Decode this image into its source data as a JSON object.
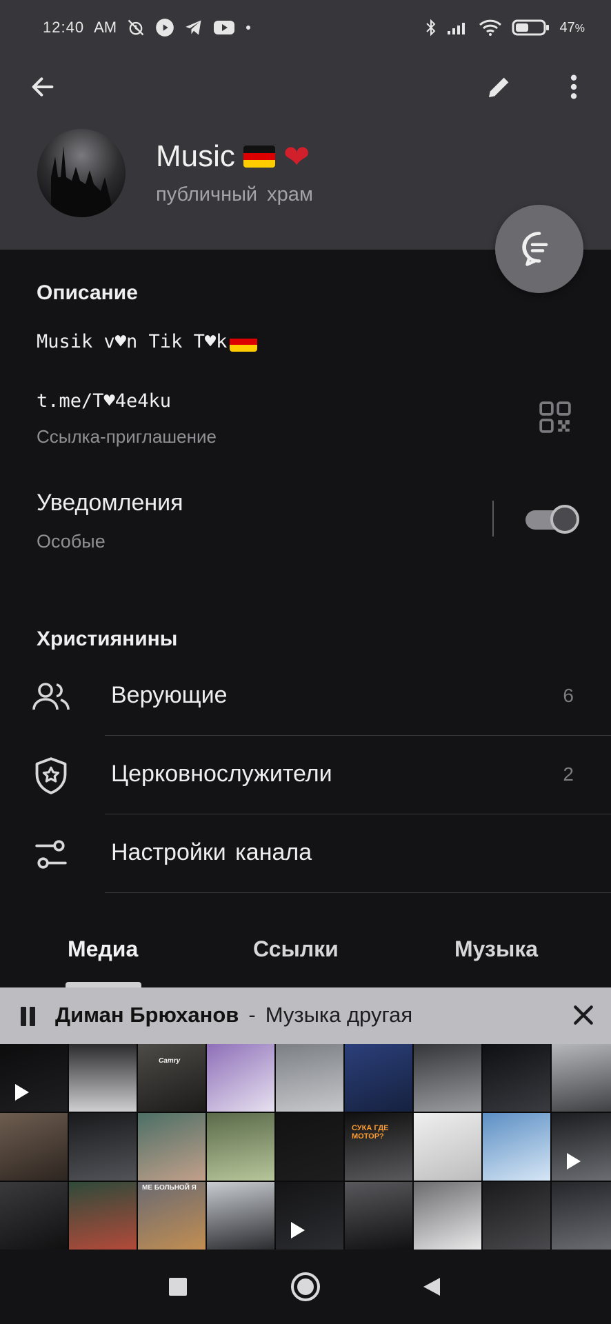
{
  "status_bar": {
    "time": "12:40",
    "ampm": "AM",
    "battery_text": "47",
    "battery_unit": "%",
    "battery_level": 0.47,
    "icons_left": [
      "alarm-off-icon",
      "youtube-music-icon",
      "telegram-icon",
      "youtube-icon",
      "dot-icon"
    ],
    "icons_right": [
      "bluetooth-icon",
      "signal-icon",
      "wifi-icon",
      "battery-icon"
    ]
  },
  "header": {
    "back_icon": "arrow-left-icon",
    "edit_icon": "pencil-icon",
    "more_icon": "more-vertical-icon",
    "channel_name": "Music",
    "channel_emoji": [
      "flag-germany",
      "red-heart"
    ],
    "channel_subtitle": "публичный храм"
  },
  "fab": {
    "icon": "chat-bubble-icon"
  },
  "description": {
    "section_title": "Описание",
    "text": "Musik v♥n Tik T♥k",
    "text_emoji": "flag-germany"
  },
  "invite_link": {
    "url": "t.me/T♥4e4ku",
    "label": "Ссылка-приглашение",
    "qr_icon": "qr-code-icon"
  },
  "notifications": {
    "title": "Уведомления",
    "subtitle": "Особые",
    "enabled": true
  },
  "members_section": {
    "title": "Християнины",
    "rows": [
      {
        "label": "Верующие",
        "count": "6",
        "icon": "users-icon"
      },
      {
        "label": "Церковнослужители",
        "count": "2",
        "icon": "shield-star-icon"
      },
      {
        "label": "Настройки канала",
        "count": "",
        "icon": "sliders-icon"
      }
    ]
  },
  "tabs": [
    {
      "label": "Медиа",
      "active": true
    },
    {
      "label": "Ссылки",
      "active": false
    },
    {
      "label": "Музыка",
      "active": false
    }
  ],
  "player": {
    "artist": "Диман Брюханов",
    "separator": "-",
    "track": "Музыка другая",
    "pause_icon": "pause-icon",
    "close_icon": "close-icon"
  },
  "media_grid": {
    "captions": {
      "c2": "Camry",
      "c14": "СУКА ГДЕ МОТОР?",
      "c20": "МЕ БОЛЬНОЙ Я"
    },
    "video_cells": [
      0,
      17,
      22
    ]
  },
  "nav": {
    "recents_icon": "square-icon",
    "home_icon": "circle-home-icon",
    "back_icon": "triangle-back-icon"
  }
}
